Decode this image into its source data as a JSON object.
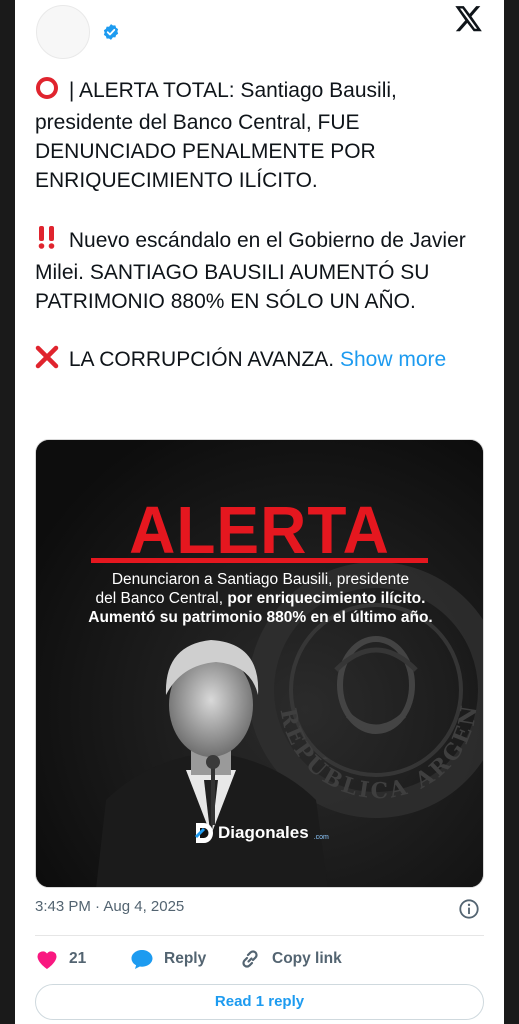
{
  "tweet": {
    "paragraphs": [
      {
        "emoji": "⭕",
        "text": "| ALERTA TOTAL: Santiago Bausili, presidente del Banco Central, FUE DENUNCIADO PENALMENTE POR ENRIQUECIMIENTO ILÍCITO."
      },
      {
        "emoji": "‼️",
        "text": "Nuevo escándalo en el Gobierno de Javier Milei. SANTIAGO BAUSILI AUMENTÓ SU PATRIMONIO 880% EN SÓLO UN AÑO."
      },
      {
        "emoji": "❌",
        "text": "LA CORRUPCIÓN AVANZA."
      }
    ],
    "show_more": "Show more",
    "timestamp": "3:43 PM · Aug 4, 2025"
  },
  "media": {
    "alert_word": "ALERTA",
    "headline_line1": "Denunciaron a Santiago Bausili, presidente",
    "headline_line2_plain": "del Banco Central, ",
    "headline_line2_bold": "por enriquecimiento ilícito.",
    "headline_line3": "Aumentó su patrimonio 880% en el último año.",
    "seal_text": "REPÚBLICA ARGENTINA",
    "brand_name": "Diagonales",
    "brand_suffix": ".com"
  },
  "actions": {
    "like_count": "21",
    "reply_label": "Reply",
    "copy_link_label": "Copy link"
  },
  "read_reply_label": "Read 1 reply",
  "colors": {
    "accent": "#1d9bf0",
    "like": "#f91880",
    "alert_red": "#e5171f"
  }
}
